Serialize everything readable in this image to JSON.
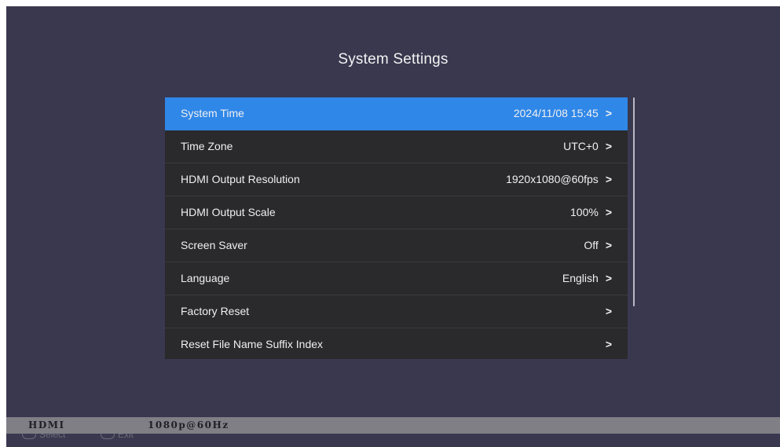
{
  "page": {
    "title": "System Settings"
  },
  "menu": {
    "items": [
      {
        "label": "System Time",
        "value": "2024/11/08 15:45",
        "chevron": ">"
      },
      {
        "label": "Time Zone",
        "value": "UTC+0",
        "chevron": ">"
      },
      {
        "label": "HDMI Output Resolution",
        "value": "1920x1080@60fps",
        "chevron": ">"
      },
      {
        "label": "HDMI Output Scale",
        "value": "100%",
        "chevron": ">"
      },
      {
        "label": "Screen Saver",
        "value": "Off",
        "chevron": ">"
      },
      {
        "label": "Language",
        "value": "English",
        "chevron": ">"
      },
      {
        "label": "Factory Reset",
        "value": "",
        "chevron": ">"
      },
      {
        "label": "Reset File Name Suffix Index",
        "value": "",
        "chevron": ">"
      }
    ]
  },
  "status": {
    "source": "HDMI",
    "resolution": "1080p@60Hz"
  },
  "hints": {
    "select": "Select",
    "exit": "Exit"
  },
  "colors": {
    "background": "#3a384f",
    "panel": "#2a2a2c",
    "selected": "#2f87e8",
    "statusbar": "#807f86"
  }
}
